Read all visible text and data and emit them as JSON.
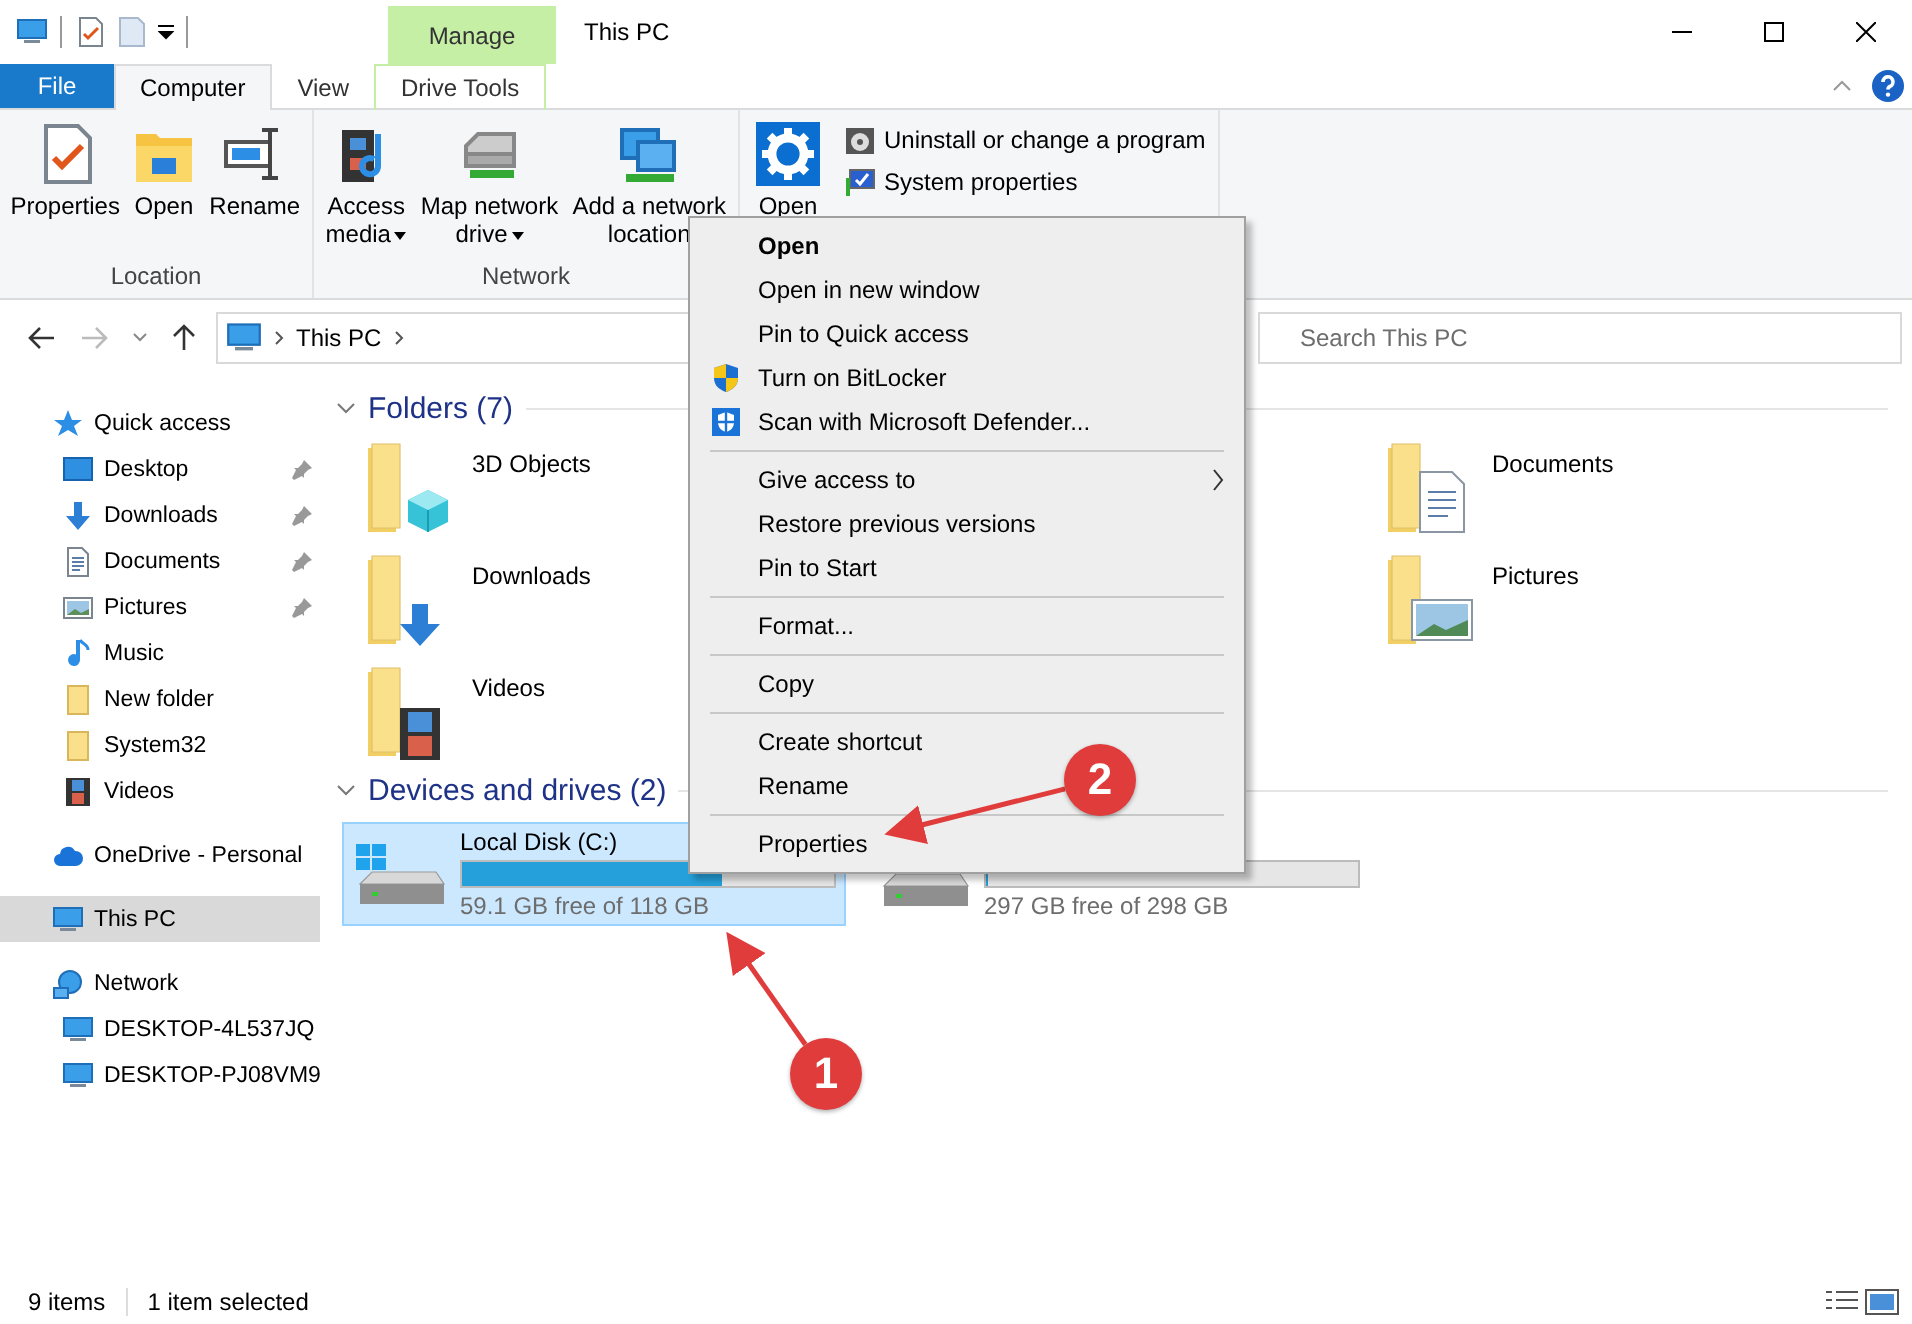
{
  "window": {
    "title": "This PC",
    "contextual_tab_group": "Manage"
  },
  "ribbon_tabs": [
    {
      "label": "File",
      "kind": "file",
      "selected": false
    },
    {
      "label": "Computer",
      "kind": "tab",
      "selected": true
    },
    {
      "label": "View",
      "kind": "tab",
      "selected": false
    },
    {
      "label": "Drive Tools",
      "kind": "contextual",
      "selected": false
    }
  ],
  "ribbon_groups": [
    {
      "label": "Location",
      "buttons": [
        {
          "label": "Properties",
          "kind": "properties",
          "dropdown": false
        },
        {
          "label": "Open",
          "kind": "open",
          "dropdown": false
        },
        {
          "label": "Rename",
          "kind": "rename",
          "dropdown": false
        }
      ]
    },
    {
      "label": "Network",
      "buttons": [
        {
          "label": "Access media",
          "kind": "media",
          "dropdown": true
        },
        {
          "label": "Map network drive",
          "kind": "mapdrive",
          "dropdown": true
        },
        {
          "label": "Add a network location",
          "kind": "netlocation",
          "dropdown": false
        }
      ]
    },
    {
      "buttons": [
        {
          "label": "Open",
          "kind": "settings",
          "dropdown": false
        }
      ],
      "small_buttons": [
        {
          "label": "Uninstall or change a program",
          "kind": "uninstall"
        },
        {
          "label": "System properties",
          "kind": "sysprops"
        }
      ]
    }
  ],
  "address_bar": {
    "path": "This PC"
  },
  "search": {
    "placeholder": "Search This PC"
  },
  "navigation": [
    {
      "label": "Quick access",
      "kind": "star",
      "selected": false,
      "children": [
        {
          "label": "Desktop",
          "kind": "desktop",
          "pinned": true,
          "selected": false
        },
        {
          "label": "Downloads",
          "kind": "download",
          "pinned": true,
          "selected": false
        },
        {
          "label": "Documents",
          "kind": "document",
          "pinned": true,
          "selected": false
        },
        {
          "label": "Pictures",
          "kind": "picture",
          "pinned": true,
          "selected": false
        },
        {
          "label": "Music",
          "kind": "music",
          "pinned": false,
          "selected": false
        },
        {
          "label": "New folder",
          "kind": "folder",
          "pinned": false,
          "selected": false
        },
        {
          "label": "System32",
          "kind": "folder",
          "pinned": false,
          "selected": false
        },
        {
          "label": "Videos",
          "kind": "video",
          "pinned": false,
          "selected": false
        }
      ]
    },
    {
      "label": "OneDrive - Personal",
      "kind": "cloud",
      "selected": false
    },
    {
      "label": "This PC",
      "kind": "pc",
      "selected": true
    },
    {
      "label": "Network",
      "kind": "network",
      "selected": false,
      "children": [
        {
          "label": "DESKTOP-4L537JQ",
          "kind": "pc",
          "selected": false
        },
        {
          "label": "DESKTOP-PJ08VM9",
          "kind": "pc",
          "selected": false
        }
      ]
    }
  ],
  "folders": {
    "title": "Folders (7)",
    "items": [
      {
        "label": "3D Objects",
        "kind": "objects3d"
      },
      {
        "label": "Documents",
        "kind": "document"
      },
      {
        "label": "Downloads",
        "kind": "download"
      },
      {
        "label": "Pictures",
        "kind": "picture"
      },
      {
        "label": "Videos",
        "kind": "video"
      }
    ]
  },
  "drives": {
    "title": "Devices and drives (2)",
    "items": [
      {
        "label": "Local Disk (C:)",
        "kind": "system",
        "level": 0.7,
        "free": "59.1 GB free of 118 GB",
        "selected": true
      },
      {
        "kind": "data",
        "level": 0.004,
        "free": "297 GB free of 298 GB",
        "selected": false
      }
    ]
  },
  "context_menu": {
    "groups": [
      [
        {
          "label": "Open",
          "default": true
        },
        {
          "label": "Open in new window",
          "default": false
        },
        {
          "label": "Pin to Quick access",
          "default": false
        },
        {
          "label": "Turn on BitLocker",
          "kind": "shield",
          "default": false
        },
        {
          "label": "Scan with Microsoft Defender...",
          "kind": "defender",
          "default": false
        }
      ],
      [
        {
          "label": "Give access to",
          "submenu": true,
          "default": false
        },
        {
          "label": "Restore previous versions",
          "default": false
        },
        {
          "label": "Pin to Start",
          "default": false
        }
      ],
      [
        {
          "label": "Format...",
          "default": false
        }
      ],
      [
        {
          "label": "Copy",
          "default": false
        }
      ],
      [
        {
          "label": "Create shortcut",
          "default": false
        },
        {
          "label": "Rename",
          "default": false
        }
      ],
      [
        {
          "label": "Properties",
          "default": false
        }
      ]
    ]
  },
  "annotations": [
    {
      "label": "1"
    },
    {
      "label": "2"
    }
  ],
  "status_bar": {
    "item_count": "9 items",
    "selection": "1 item selected"
  }
}
